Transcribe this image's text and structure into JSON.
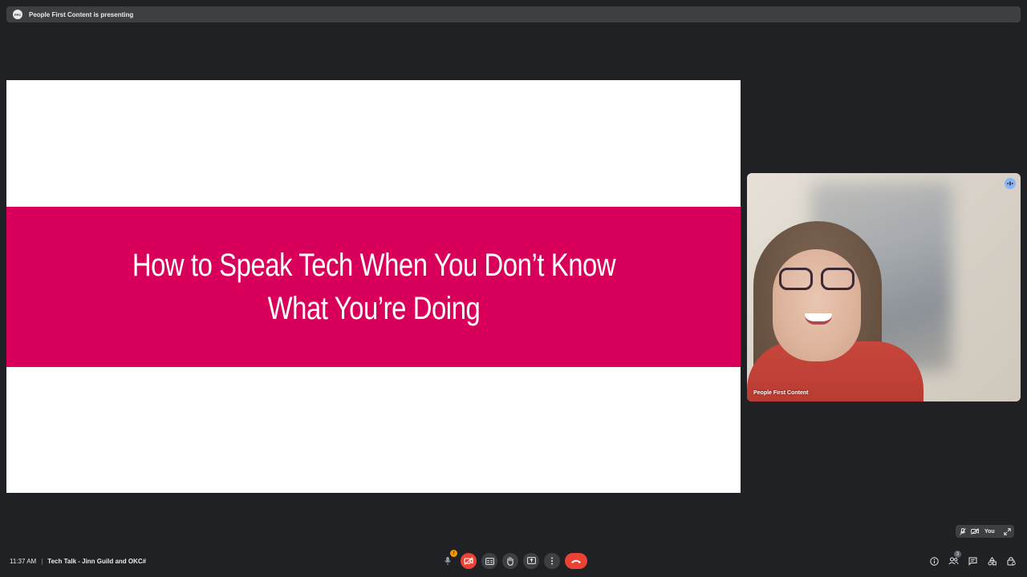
{
  "banner": {
    "avatar_initials": "PFC",
    "text": "People First Content is presenting"
  },
  "slide": {
    "title": "How to Speak Tech When You Don’t Know What You’re Doing",
    "band_color": "#d9005b",
    "background_color": "#ffffff"
  },
  "participant": {
    "name": "People First Content",
    "speaking": true
  },
  "self_view": {
    "label": "You"
  },
  "footer": {
    "time": "11:37 AM",
    "separator": "|",
    "meeting_name": "Tech Talk - Jinn Guild and OKC#"
  },
  "controls": {
    "mic_badge": "!",
    "people_count": "3"
  },
  "colors": {
    "background": "#202124",
    "control_bg": "#3c4043",
    "danger": "#ea4335",
    "speaking": "#8ab4f8",
    "warning": "#f29900"
  },
  "icons": {
    "mic": "mic-off-icon",
    "camera": "camera-off-icon",
    "captions": "captions-icon",
    "hand": "raise-hand-icon",
    "present": "present-icon",
    "more": "more-vert-icon",
    "hangup": "hangup-icon",
    "info": "info-icon",
    "people": "people-icon",
    "chat": "chat-icon",
    "activities": "activities-icon",
    "host_controls": "lock-person-icon"
  }
}
